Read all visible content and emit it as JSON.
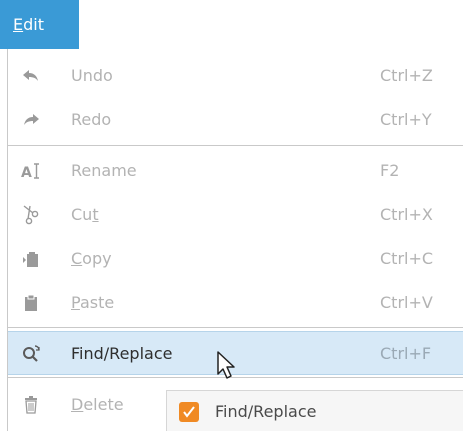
{
  "menubar": {
    "active_menu": "Edit",
    "active_menu_mnemonic": "E",
    "active_menu_rest": "dit",
    "color": "#3a9ad6"
  },
  "edit_menu": {
    "items": [
      {
        "label": "Undo",
        "shortcut": "Ctrl+Z",
        "icon": "undo-icon",
        "enabled": false
      },
      {
        "label": "Redo",
        "shortcut": "Ctrl+Y",
        "icon": "redo-icon",
        "enabled": false
      },
      {
        "label": "Rename",
        "shortcut": "F2",
        "icon": "rename-icon",
        "enabled": false
      },
      {
        "label": "Cut",
        "label_pre": "Cu",
        "label_mn": "t",
        "label_post": "",
        "shortcut": "Ctrl+X",
        "icon": "scissors-icon",
        "enabled": false
      },
      {
        "label": "Copy",
        "label_pre": "",
        "label_mn": "C",
        "label_post": "opy",
        "shortcut": "Ctrl+C",
        "icon": "copy-icon",
        "enabled": false
      },
      {
        "label": "Paste",
        "label_pre": "",
        "label_mn": "P",
        "label_post": "aste",
        "shortcut": "Ctrl+V",
        "icon": "paste-icon",
        "enabled": false
      },
      {
        "label": "Find/Replace",
        "shortcut": "Ctrl+F",
        "icon": "find-replace-icon",
        "enabled": true,
        "hovered": true
      },
      {
        "label": "Delete",
        "label_pre": "",
        "label_mn": "D",
        "label_post": "elete",
        "shortcut": "",
        "icon": "trash-icon",
        "enabled": false
      }
    ]
  },
  "taskbar": {
    "label": "Find/Replace",
    "icon": "app-icon",
    "icon_color": "#f08a24"
  }
}
